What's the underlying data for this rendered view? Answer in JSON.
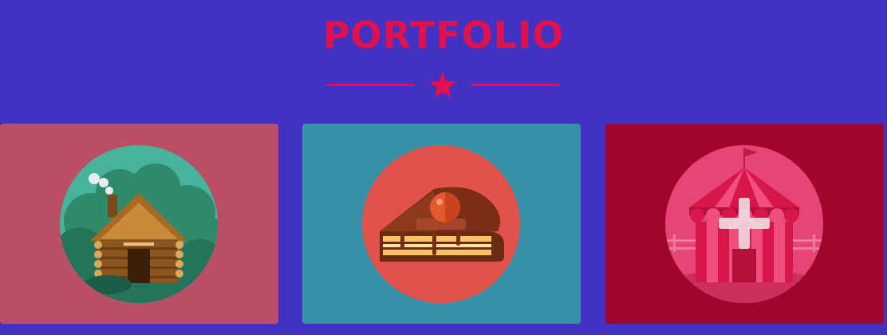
{
  "header": {
    "title": "PORTFOLIO",
    "divider_icon": "star-icon"
  },
  "colors": {
    "background": "#4232c2",
    "accent": "#e0114f"
  },
  "portfolio": {
    "items": [
      {
        "icon": "log-cabin-icon",
        "background": "#b94f67",
        "circle": "#47b39a"
      },
      {
        "icon": "cake-slice-icon",
        "background": "#3590a8",
        "circle": "#e0524a"
      },
      {
        "icon": "circus-tent-icon",
        "background": "#a1052c",
        "circle": "#e54675",
        "overlay_icon": "plus-icon"
      }
    ]
  }
}
